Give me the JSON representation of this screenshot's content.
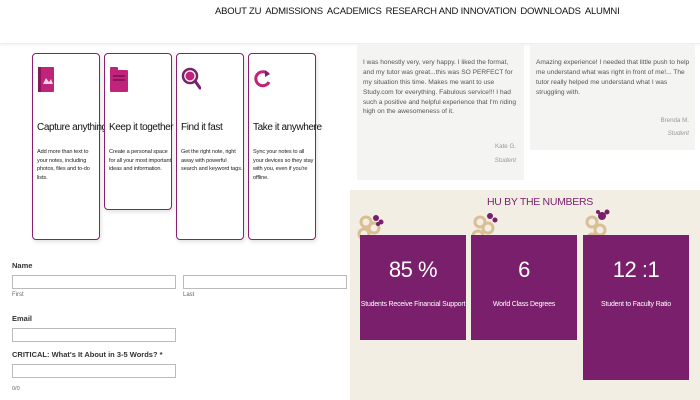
{
  "nav": {
    "items": [
      "ABOUT ZU",
      "ADMISSIONS",
      "ACADEMICS",
      "RESEARCH AND INNOVATION",
      "DOWNLOADS",
      "ALUMNI"
    ]
  },
  "features": [
    {
      "title": "Capture anything",
      "desc": "Add more than text to your notes, including photos, files and to-do lists.",
      "icon": "notebook-icon"
    },
    {
      "title": "Keep it together",
      "desc": "Create a personal space for all your most important ideas and information.",
      "icon": "folder-icon"
    },
    {
      "title": "Find it fast",
      "desc": "Get the right note, right away with powerful search and keyword tags.",
      "icon": "search-icon"
    },
    {
      "title": "Take it anywhere",
      "desc": "Sync your notes to all your devices so they stay with you, even if you're offline.",
      "icon": "sync-icon"
    }
  ],
  "form": {
    "name_label": "Name",
    "first_label": "First",
    "last_label": "Last",
    "email_label": "Email",
    "critical_label": "CRITICAL: What's It About in 3-5 Words? *",
    "counter": "0/0"
  },
  "testimonials": [
    {
      "text": "I was honestly very, very happy. I liked the format, and my tutor was great...this was SO PERFECT for my situation this time. Makes me want to use Study.com for everything. Fabulous service!!! I had such a positive and helpful experience that I'm riding high on the awesomeness of it.",
      "name": "Kate G.",
      "role": "Student"
    },
    {
      "text": "Amazing experience! I needed that little push to help me understand what was right in front of me!... The tutor really helped me understand what I was struggling with.",
      "name": "Brenda M.",
      "role": "Student"
    }
  ],
  "numbers": {
    "title": "HU BY THE NUMBERS",
    "stats": [
      {
        "value": "85 %",
        "label": "Students Receive Financial Support"
      },
      {
        "value": "6",
        "label": "World Class Degrees"
      },
      {
        "value": "12 :1",
        "label": "Student to Faculty Ratio"
      }
    ]
  },
  "colors": {
    "brand_purple": "#7a1f6b",
    "icon_magenta": "#c0237a",
    "section_bg": "#f3eee4",
    "testimonial_bg": "#f4f4f3",
    "flower_tan": "#d9bf95"
  }
}
